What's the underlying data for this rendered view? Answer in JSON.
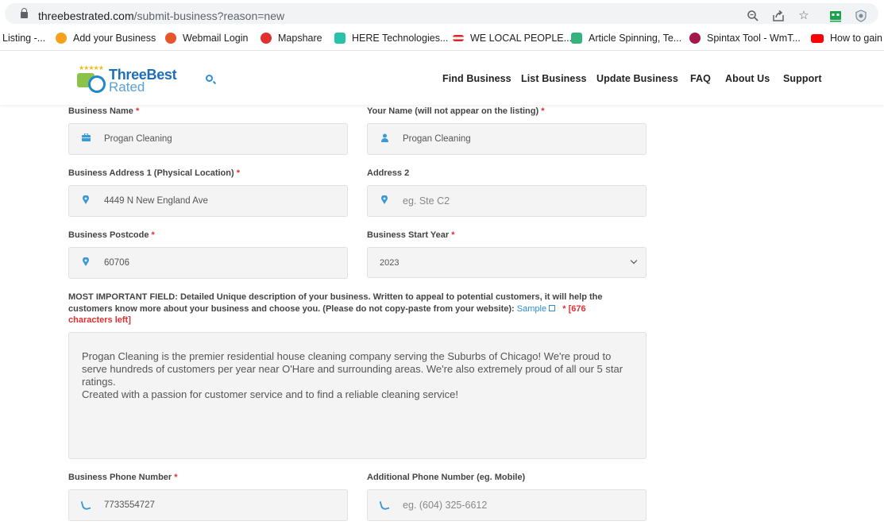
{
  "browser": {
    "url_domain": "threebestrated.com",
    "url_path": "/submit-business?reason=new",
    "bookmarks": [
      {
        "label": "Listing -...",
        "color": ""
      },
      {
        "label": "Add your Business",
        "color": "#f4a21b"
      },
      {
        "label": "Webmail Login",
        "color": "#e8552d"
      },
      {
        "label": "Mapshare",
        "color": "#e0312f"
      },
      {
        "label": "HERE Technologies...",
        "color": "#27c3a9"
      },
      {
        "label": "WE LOCAL PEOPLE...",
        "color": "#d8232a"
      },
      {
        "label": "Article Spinning, Te...",
        "color": "#35b37e"
      },
      {
        "label": "Spintax Tool - WmT...",
        "color": "#a3184a"
      },
      {
        "label": "How to gain",
        "color": "#ff0000"
      }
    ]
  },
  "header": {
    "logo_line1": "ThreeBest",
    "logo_line2": "Rated",
    "nav": [
      "Find Business",
      "List Business",
      "Update Business",
      "FAQ",
      "About Us",
      "Support"
    ]
  },
  "form": {
    "business_name": {
      "label": "Business Name",
      "value": "Progan Cleaning"
    },
    "your_name": {
      "label": "Your Name (will not appear on the listing)",
      "value": "Progan Cleaning"
    },
    "address1": {
      "label": "Business Address 1 (Physical Location)",
      "value": "4449 N New England Ave"
    },
    "address2": {
      "label": "Address 2",
      "placeholder": "eg. Ste C2"
    },
    "postcode": {
      "label": "Business Postcode",
      "value": "60706"
    },
    "start_year": {
      "label": "Business Start Year",
      "value": "2023"
    },
    "description": {
      "label": "MOST IMPORTANT FIELD: Detailed Unique description of your business. Written to appeal to potential customers, it will help the customers know more about your business and choose you. (Please do not copy-paste from your website):",
      "sample_link": "Sample",
      "chars_left": "[676 characters left]",
      "text_p1": "Progan Cleaning is the premier residential house cleaning company serving the Suburbs of Chicago! We're proud to serve hundreds of customers per year near O'Hare and surrounding areas. We're also extremely proud of all our 5 star ratings.",
      "text_p2": "Created with a passion for customer service and to find a reliable cleaning service!"
    },
    "phone": {
      "label": "Business Phone Number",
      "value": "7733554727"
    },
    "additional_phone": {
      "label": "Additional Phone Number (eg. Mobile)",
      "placeholder": "eg. (604) 325-6612"
    },
    "required_mark": "*"
  }
}
